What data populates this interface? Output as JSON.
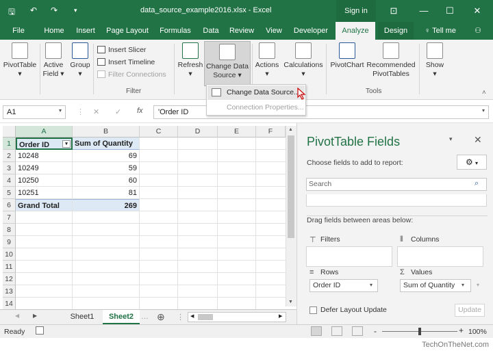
{
  "window": {
    "doc_title": "data_source_example2016.xlsx - Excel",
    "signin": "Sign in",
    "minimize": "—",
    "restore": "☐",
    "close": "✕",
    "ribbon_opts": "⊡",
    "undo": "↶",
    "redo": "↷",
    "save": "🖫"
  },
  "tabs": {
    "file": "File",
    "home": "Home",
    "insert": "Insert",
    "page_layout": "Page Layout",
    "formulas": "Formulas",
    "data": "Data",
    "review": "Review",
    "view": "View",
    "developer": "Developer",
    "analyze": "Analyze",
    "design": "Design",
    "tell_me": "Tell me"
  },
  "ribbon": {
    "pivottable": "PivotTable",
    "active_field_1": "Active",
    "active_field_2": "Field",
    "group": "Group",
    "insert_slicer": "Insert Slicer",
    "insert_timeline": "Insert Timeline",
    "filter_connections": "Filter Connections",
    "filter_group": "Filter",
    "refresh": "Refresh",
    "change_ds_1": "Change Data",
    "change_ds_2": "Source",
    "actions": "Actions",
    "calculations": "Calculations",
    "pivotchart": "PivotChart",
    "recommended_1": "Recommended",
    "recommended_2": "PivotTables",
    "tools_group": "Tools",
    "show": "Show"
  },
  "dropdown": {
    "change_data_source": "Change Data Source...",
    "connection_properties": "Connection Properties..."
  },
  "formula_bar": {
    "name_box": "A1",
    "cancel": "✕",
    "enter": "✓",
    "fx": "fx",
    "value": "'Order ID"
  },
  "columns": [
    "A",
    "B",
    "C",
    "D",
    "E",
    "F"
  ],
  "rows": [
    "1",
    "2",
    "3",
    "4",
    "5",
    "6",
    "7",
    "8",
    "9",
    "10",
    "11",
    "12",
    "13",
    "14"
  ],
  "table": {
    "header_a": "Order ID",
    "header_b": "Sum of Quantity",
    "data": [
      {
        "id": "10248",
        "qty": "69"
      },
      {
        "id": "10249",
        "qty": "59"
      },
      {
        "id": "10250",
        "qty": "60"
      },
      {
        "id": "10251",
        "qty": "81"
      }
    ],
    "total_label": "Grand Total",
    "total_value": "269"
  },
  "sheets": {
    "sheet1": "Sheet1",
    "sheet2": "Sheet2",
    "add": "⊕"
  },
  "pivot_pane": {
    "title": "PivotTable Fields",
    "subtitle": "Choose fields to add to report:",
    "search_placeholder": "Search",
    "drag_text": "Drag fields between areas below:",
    "filters": "Filters",
    "columns": "Columns",
    "rows": "Rows",
    "values": "Values",
    "rows_field": "Order ID",
    "values_field": "Sum of Quantity",
    "defer": "Defer Layout Update",
    "update": "Update"
  },
  "status": {
    "ready": "Ready",
    "zoom": "100%",
    "minus": "-",
    "plus": "+"
  },
  "footer": {
    "credit": "TechOnTheNet.com"
  },
  "colors": {
    "excel_green": "#217346",
    "pivot_blue": "#dde9f5"
  }
}
